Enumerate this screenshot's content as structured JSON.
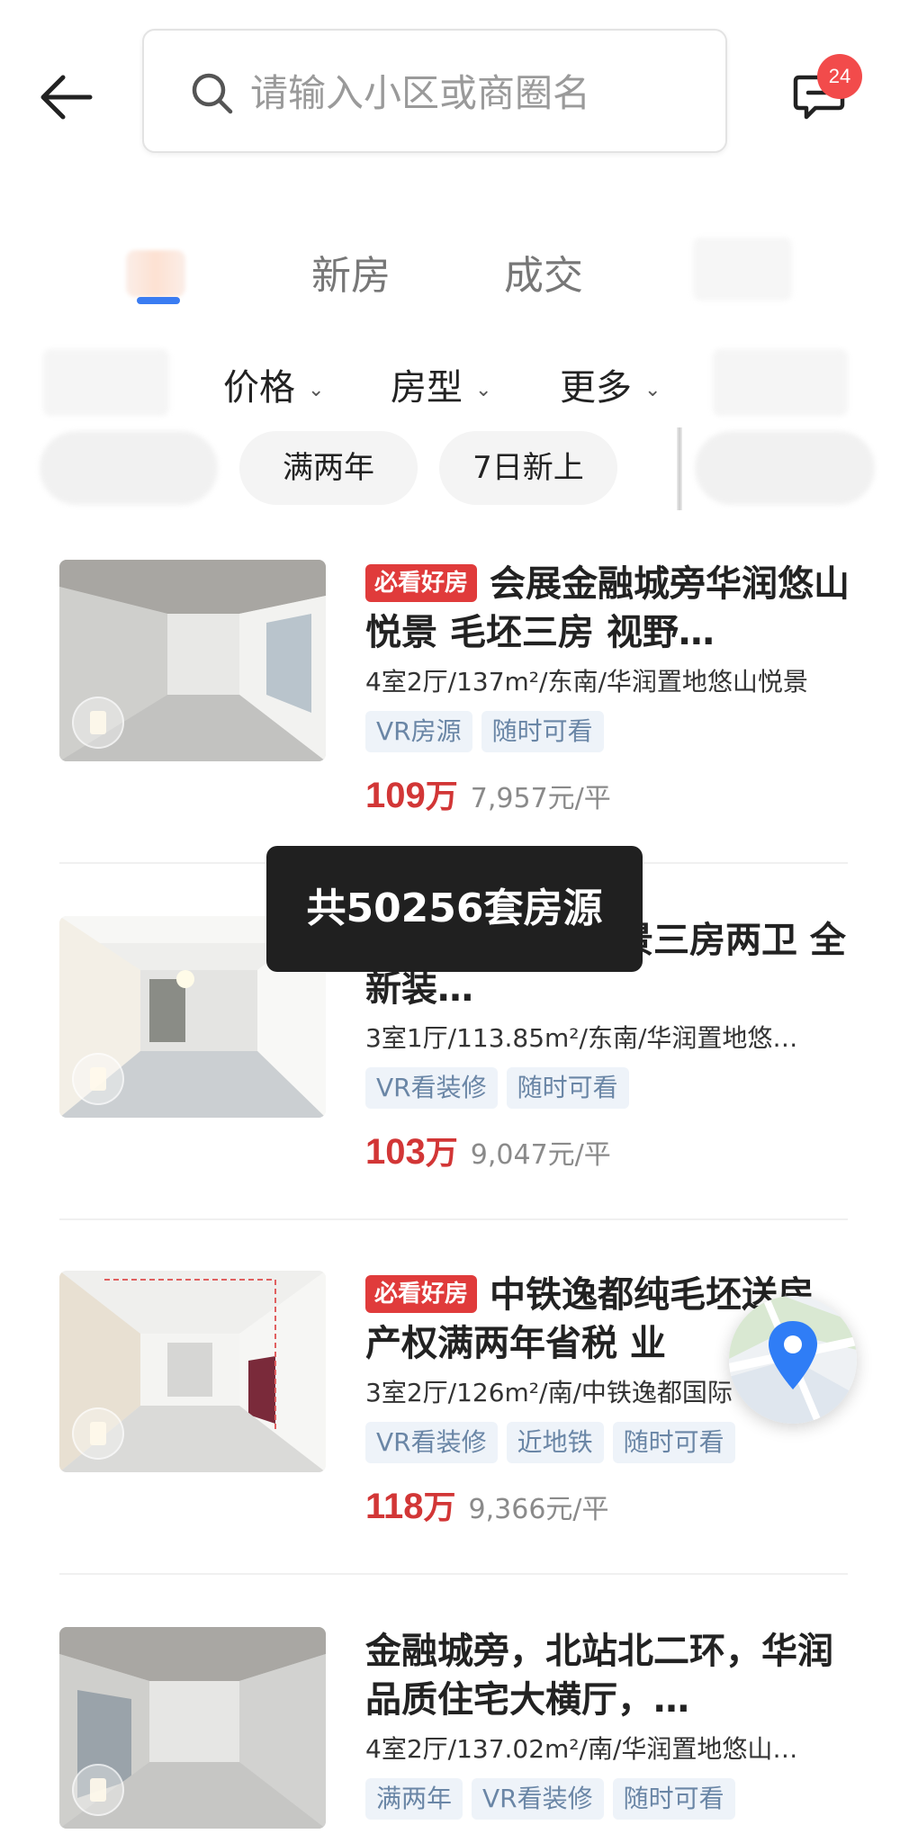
{
  "header": {
    "search_placeholder": "请输入小区或商圈名",
    "message_badge": "24"
  },
  "tabs": [
    {
      "label": "新房"
    },
    {
      "label": "成交"
    }
  ],
  "filters": [
    {
      "label": "价格"
    },
    {
      "label": "房型"
    },
    {
      "label": "更多"
    }
  ],
  "chips": [
    {
      "label": "满两年"
    },
    {
      "label": "7日新上"
    }
  ],
  "listings": [
    {
      "badge": "必看好房",
      "title": "会展金融城旁华润悠山悦景 毛坯三房 视野…",
      "spec": "4室2厅/137m²/东南/华润置地悠山悦景",
      "tags": [
        "VR房源",
        "随时可看"
      ],
      "price": "109",
      "price_unit": "万",
      "unit_price": "7,957元/平"
    },
    {
      "badge": "",
      "title": "荐：华润悠山悦景三房两卫 全新装…",
      "spec": "3室1厅/113.85m²/东南/华润置地悠…",
      "tags": [
        "VR看装修",
        "随时可看"
      ],
      "price": "103",
      "price_unit": "万",
      "unit_price": "9,047元/平"
    },
    {
      "badge": "必看好房",
      "title": "中铁逸都纯毛坯送房 产权满两年省税 业",
      "spec": "3室2厅/126m²/南/中铁逸都国际",
      "tags": [
        "VR看装修",
        "近地铁",
        "随时可看"
      ],
      "price": "118",
      "price_unit": "万",
      "unit_price": "9,366元/平"
    },
    {
      "badge": "",
      "title": "金融城旁，北站北二环，华润品质住宅大横厅，…",
      "spec": "4室2厅/137.02m²/南/华润置地悠山…",
      "tags": [
        "满两年",
        "VR看装修",
        "随时可看"
      ],
      "price": "",
      "price_unit": "",
      "unit_price": ""
    }
  ],
  "toast": {
    "text": "共50256套房源"
  },
  "colors": {
    "accent_blue": "#3a7cf2",
    "price_red": "#d23636",
    "badge_red": "#e03b3b",
    "tag_text": "#6a86a6",
    "tag_bg": "#eef3f9"
  }
}
